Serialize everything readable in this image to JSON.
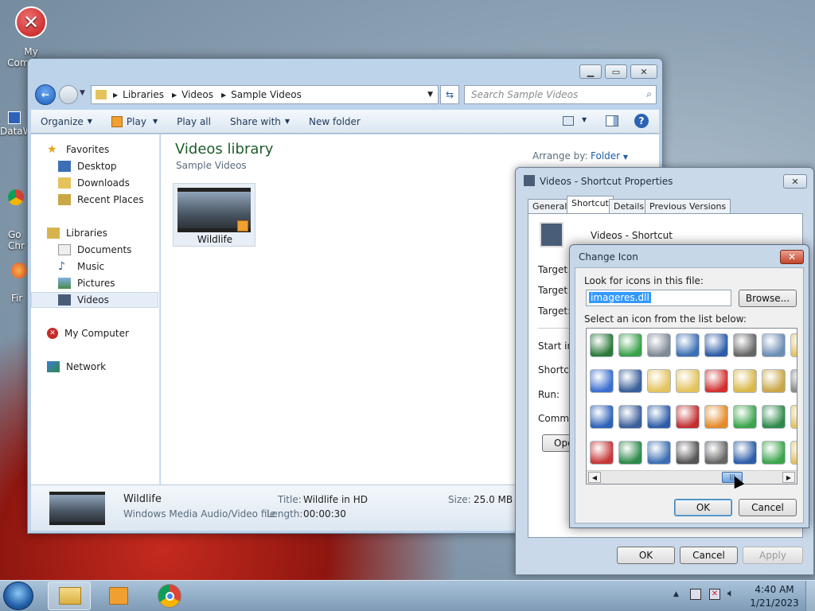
{
  "desktop": {
    "icons": [
      {
        "label": "My Computer"
      },
      {
        "label": "DataW"
      },
      {
        "label": "Go\nChr"
      },
      {
        "label": "Fir"
      }
    ]
  },
  "explorer": {
    "breadcrumb": [
      "Libraries",
      "Videos",
      "Sample Videos"
    ],
    "search_placeholder": "Search Sample Videos",
    "toolbar": {
      "organize": "Organize",
      "play": "Play",
      "play_all": "Play all",
      "share_with": "Share with",
      "new_folder": "New folder"
    },
    "nav": {
      "favorites": "Favorites",
      "desktop": "Desktop",
      "downloads": "Downloads",
      "recent_places": "Recent Places",
      "libraries": "Libraries",
      "documents": "Documents",
      "music": "Music",
      "pictures": "Pictures",
      "videos": "Videos",
      "my_computer": "My Computer",
      "network": "Network"
    },
    "main": {
      "title": "Videos library",
      "subtitle": "Sample Videos",
      "arrange_by_label": "Arrange by:",
      "arrange_by_value": "Folder",
      "file_name": "Wildlife"
    },
    "details": {
      "name": "Wildlife",
      "type": "Windows Media Audio/Video file",
      "title_label": "Title:",
      "title_value": "Wildlife in HD",
      "length_label": "Length:",
      "length_value": "00:00:30",
      "size_label": "Size:",
      "size_value": "25.0 MB"
    }
  },
  "properties": {
    "title": "Videos - Shortcut Properties",
    "tabs": [
      "General",
      "Shortcut",
      "Details",
      "Previous Versions"
    ],
    "active_tab": "Shortcut",
    "shortcut_name": "Videos - Shortcut",
    "fields": [
      "Target t",
      "Target lo",
      "Target:",
      "Start in:",
      "Shortcut",
      "Run:",
      "Commen"
    ],
    "open_button": "Ope",
    "ok": "OK",
    "cancel": "Cancel",
    "apply": "Apply"
  },
  "change_icon": {
    "title": "Change Icon",
    "look_label": "Look for icons in this file:",
    "file_value": "imageres.dll",
    "browse": "Browse...",
    "select_label": "Select an icon from the list below:",
    "ok": "OK",
    "cancel": "Cancel",
    "icons": [
      {
        "name": "monitor-icon",
        "c": "#2c7a3a"
      },
      {
        "name": "check-icon",
        "c": "#3aa04a"
      },
      {
        "name": "cabinet-icon",
        "c": "#7f8a96"
      },
      {
        "name": "checklist-icon",
        "c": "#3b6fb3"
      },
      {
        "name": "download-arrow-icon",
        "c": "#2d5da8"
      },
      {
        "name": "dvd-rw-icon",
        "c": "#666666"
      },
      {
        "name": "magnifier-icon",
        "c": "#6a8eb4"
      },
      {
        "name": "folder-icon",
        "c": "#e4c35c"
      },
      {
        "name": "screen-colors-icon",
        "c": "#3a6fd0"
      },
      {
        "name": "text-doc-icon",
        "c": "#3a5f9a"
      },
      {
        "name": "folder-zip-icon",
        "c": "#e4c35c"
      },
      {
        "name": "folder-tasks-icon",
        "c": "#e4c35c"
      },
      {
        "name": "red-x-icon",
        "c": "#d23030"
      },
      {
        "name": "zip-icon",
        "c": "#d9b84a"
      },
      {
        "name": "users-folder-icon",
        "c": "#c9a747"
      },
      {
        "name": "cd-icon",
        "c": "#888888"
      },
      {
        "name": "network-pc-icon",
        "c": "#2e62b8"
      },
      {
        "name": "font-doc-icon",
        "c": "#3a5f9a"
      },
      {
        "name": "shortcut-arrow-icon",
        "c": "#2d5da8"
      },
      {
        "name": "disconnect-icon",
        "c": "#c22f2f"
      },
      {
        "name": "share-pc-icon",
        "c": "#e48a2a"
      },
      {
        "name": "recycle-green-icon",
        "c": "#3ba44c"
      },
      {
        "name": "globe-icon",
        "c": "#2e8a4a"
      },
      {
        "name": "folder2-icon",
        "c": "#e4c35c"
      },
      {
        "name": "power-icon",
        "c": "#c73838"
      },
      {
        "name": "opera-doc-icon",
        "c": "#2e8a4a"
      },
      {
        "name": "photo-doc-icon",
        "c": "#3b6fb3"
      },
      {
        "name": "printer-icon",
        "c": "#555555"
      },
      {
        "name": "dvd-r-icon",
        "c": "#666666"
      },
      {
        "name": "speaker-icon",
        "c": "#2d5da8"
      },
      {
        "name": "music-add-icon",
        "c": "#3ba44c"
      },
      {
        "name": "folder3-icon",
        "c": "#e4c35c"
      }
    ]
  },
  "taskbar": {
    "time": "4:40 AM",
    "date": "1/21/2023"
  }
}
